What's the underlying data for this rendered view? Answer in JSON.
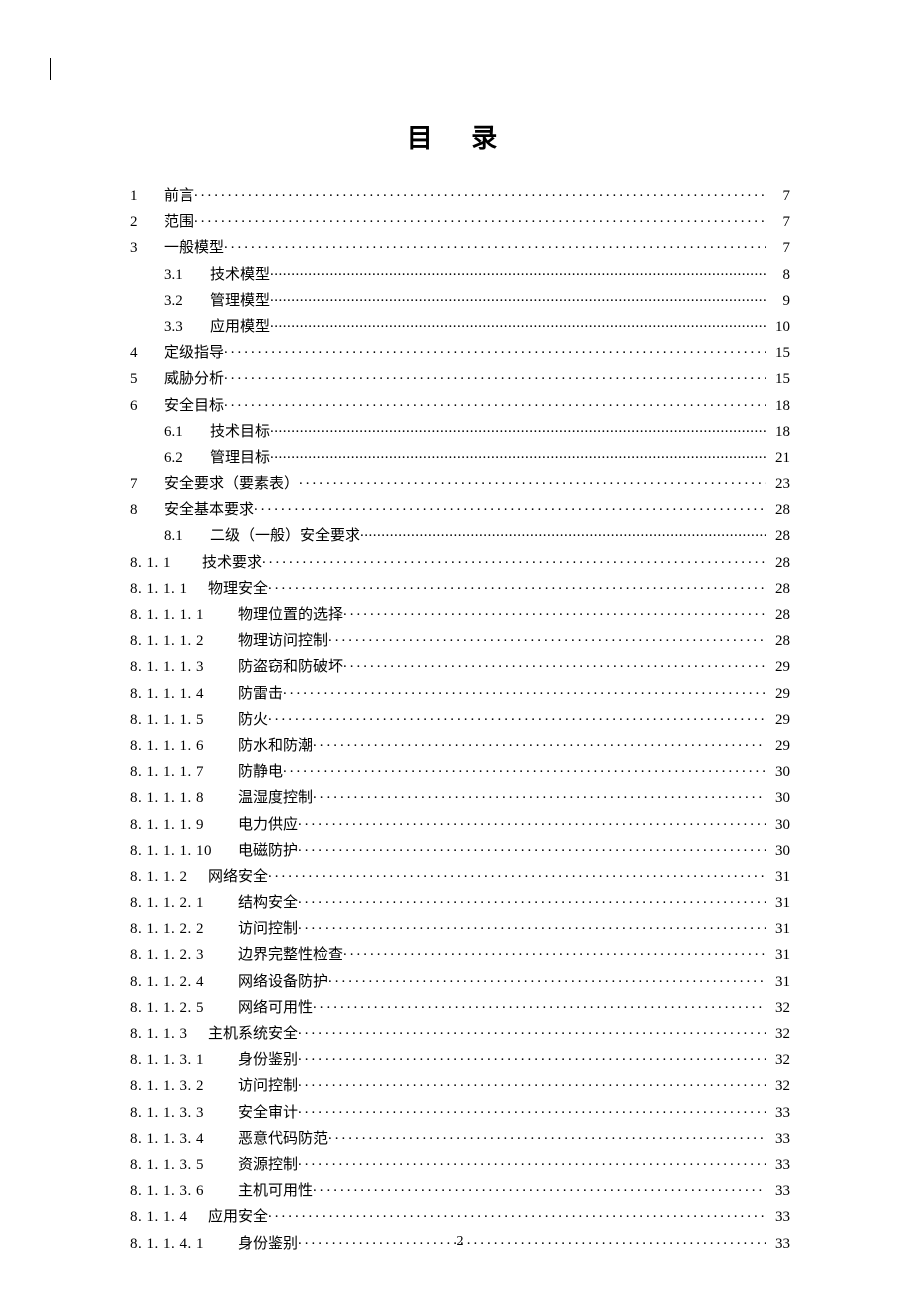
{
  "title": "目 录",
  "page_number": "2",
  "toc": [
    {
      "num": "1",
      "label": "前言",
      "page": "7",
      "lvl": "top",
      "leader": "dots"
    },
    {
      "num": "2",
      "label": "范围",
      "page": "7",
      "lvl": "top",
      "leader": "dots"
    },
    {
      "num": "3",
      "label": "一般模型",
      "page": "7",
      "lvl": "top",
      "leader": "dots"
    },
    {
      "num": "3.1",
      "label": "技术模型",
      "page": "8",
      "lvl": "sub",
      "leader": "fine"
    },
    {
      "num": "3.2",
      "label": "管理模型",
      "page": "9",
      "lvl": "sub",
      "leader": "fine"
    },
    {
      "num": "3.3",
      "label": "应用模型",
      "page": "10",
      "lvl": "sub",
      "leader": "fine"
    },
    {
      "num": "4",
      "label": "定级指导",
      "page": "15",
      "lvl": "top",
      "leader": "dots"
    },
    {
      "num": "5",
      "label": "威胁分析",
      "page": "15",
      "lvl": "top",
      "leader": "dots"
    },
    {
      "num": "6",
      "label": "安全目标",
      "page": "18",
      "lvl": "top",
      "leader": "dots"
    },
    {
      "num": "6.1",
      "label": "技术目标",
      "page": "18",
      "lvl": "sub",
      "leader": "fine"
    },
    {
      "num": "6.2",
      "label": "管理目标",
      "page": "21",
      "lvl": "sub",
      "leader": "fine"
    },
    {
      "num": "7",
      "label": "安全要求（要素表）",
      "page": "23",
      "lvl": "top",
      "leader": "dots"
    },
    {
      "num": "8",
      "label": "安全基本要求",
      "page": "28",
      "lvl": "top",
      "leader": "dots"
    },
    {
      "num": "8.1",
      "label": "二级（一般）安全要求",
      "page": "28",
      "lvl": "sub",
      "leader": "fine"
    },
    {
      "num": "8.1.1",
      "label": "技术要求",
      "page": "28",
      "lvl": "deep",
      "leader": "dots"
    },
    {
      "num": "8.1.1.1",
      "label": "物理安全",
      "page": "28",
      "lvl": "deep",
      "leader": "dots"
    },
    {
      "num": "8.1.1.1.1",
      "label": "物理位置的选择",
      "page": "28",
      "lvl": "deep2",
      "leader": "dots"
    },
    {
      "num": "8.1.1.1.2",
      "label": "物理访问控制",
      "page": "28",
      "lvl": "deep2",
      "leader": "dots"
    },
    {
      "num": "8.1.1.1.3",
      "label": "防盗窃和防破坏",
      "page": "29",
      "lvl": "deep2",
      "leader": "dots"
    },
    {
      "num": "8.1.1.1.4",
      "label": "防雷击",
      "page": "29",
      "lvl": "deep2",
      "leader": "dots"
    },
    {
      "num": "8.1.1.1.5",
      "label": "防火",
      "page": "29",
      "lvl": "deep2",
      "leader": "dots"
    },
    {
      "num": "8.1.1.1.6",
      "label": "防水和防潮",
      "page": "29",
      "lvl": "deep2",
      "leader": "dots"
    },
    {
      "num": "8.1.1.1.7",
      "label": "防静电",
      "page": "30",
      "lvl": "deep2",
      "leader": "dots"
    },
    {
      "num": "8.1.1.1.8",
      "label": "温湿度控制",
      "page": "30",
      "lvl": "deep2",
      "leader": "dots"
    },
    {
      "num": "8.1.1.1.9",
      "label": "电力供应",
      "page": "30",
      "lvl": "deep2",
      "leader": "dots"
    },
    {
      "num": "8.1.1.1.10",
      "label": "电磁防护",
      "page": "30",
      "lvl": "deep2",
      "leader": "dots"
    },
    {
      "num": "8.1.1.2",
      "label": "网络安全",
      "page": "31",
      "lvl": "deep",
      "leader": "dots"
    },
    {
      "num": "8.1.1.2.1",
      "label": "结构安全",
      "page": "31",
      "lvl": "deep2",
      "leader": "dots"
    },
    {
      "num": "8.1.1.2.2",
      "label": "访问控制",
      "page": "31",
      "lvl": "deep2",
      "leader": "dots"
    },
    {
      "num": "8.1.1.2.3",
      "label": "边界完整性检查",
      "page": "31",
      "lvl": "deep2",
      "leader": "dots"
    },
    {
      "num": "8.1.1.2.4",
      "label": "网络设备防护",
      "page": "31",
      "lvl": "deep2",
      "leader": "dots"
    },
    {
      "num": "8.1.1.2.5",
      "label": "网络可用性",
      "page": "32",
      "lvl": "deep2",
      "leader": "dots"
    },
    {
      "num": "8.1.1.3",
      "label": "主机系统安全",
      "page": "32",
      "lvl": "deep",
      "leader": "dots"
    },
    {
      "num": "8.1.1.3.1",
      "label": "身份鉴别",
      "page": "32",
      "lvl": "deep2",
      "leader": "dots"
    },
    {
      "num": "8.1.1.3.2",
      "label": "访问控制",
      "page": "32",
      "lvl": "deep2",
      "leader": "dots"
    },
    {
      "num": "8.1.1.3.3",
      "label": "安全审计",
      "page": "33",
      "lvl": "deep2",
      "leader": "dots"
    },
    {
      "num": "8.1.1.3.4",
      "label": "恶意代码防范",
      "page": "33",
      "lvl": "deep2",
      "leader": "dots"
    },
    {
      "num": "8.1.1.3.5",
      "label": "资源控制",
      "page": "33",
      "lvl": "deep2",
      "leader": "dots"
    },
    {
      "num": "8.1.1.3.6",
      "label": "主机可用性",
      "page": "33",
      "lvl": "deep2",
      "leader": "dots"
    },
    {
      "num": "8.1.1.4",
      "label": "应用安全",
      "page": "33",
      "lvl": "deep",
      "leader": "dots"
    },
    {
      "num": "8.1.1.4.1",
      "label": "身份鉴别",
      "page": "33",
      "lvl": "deep2",
      "leader": "dots"
    }
  ]
}
